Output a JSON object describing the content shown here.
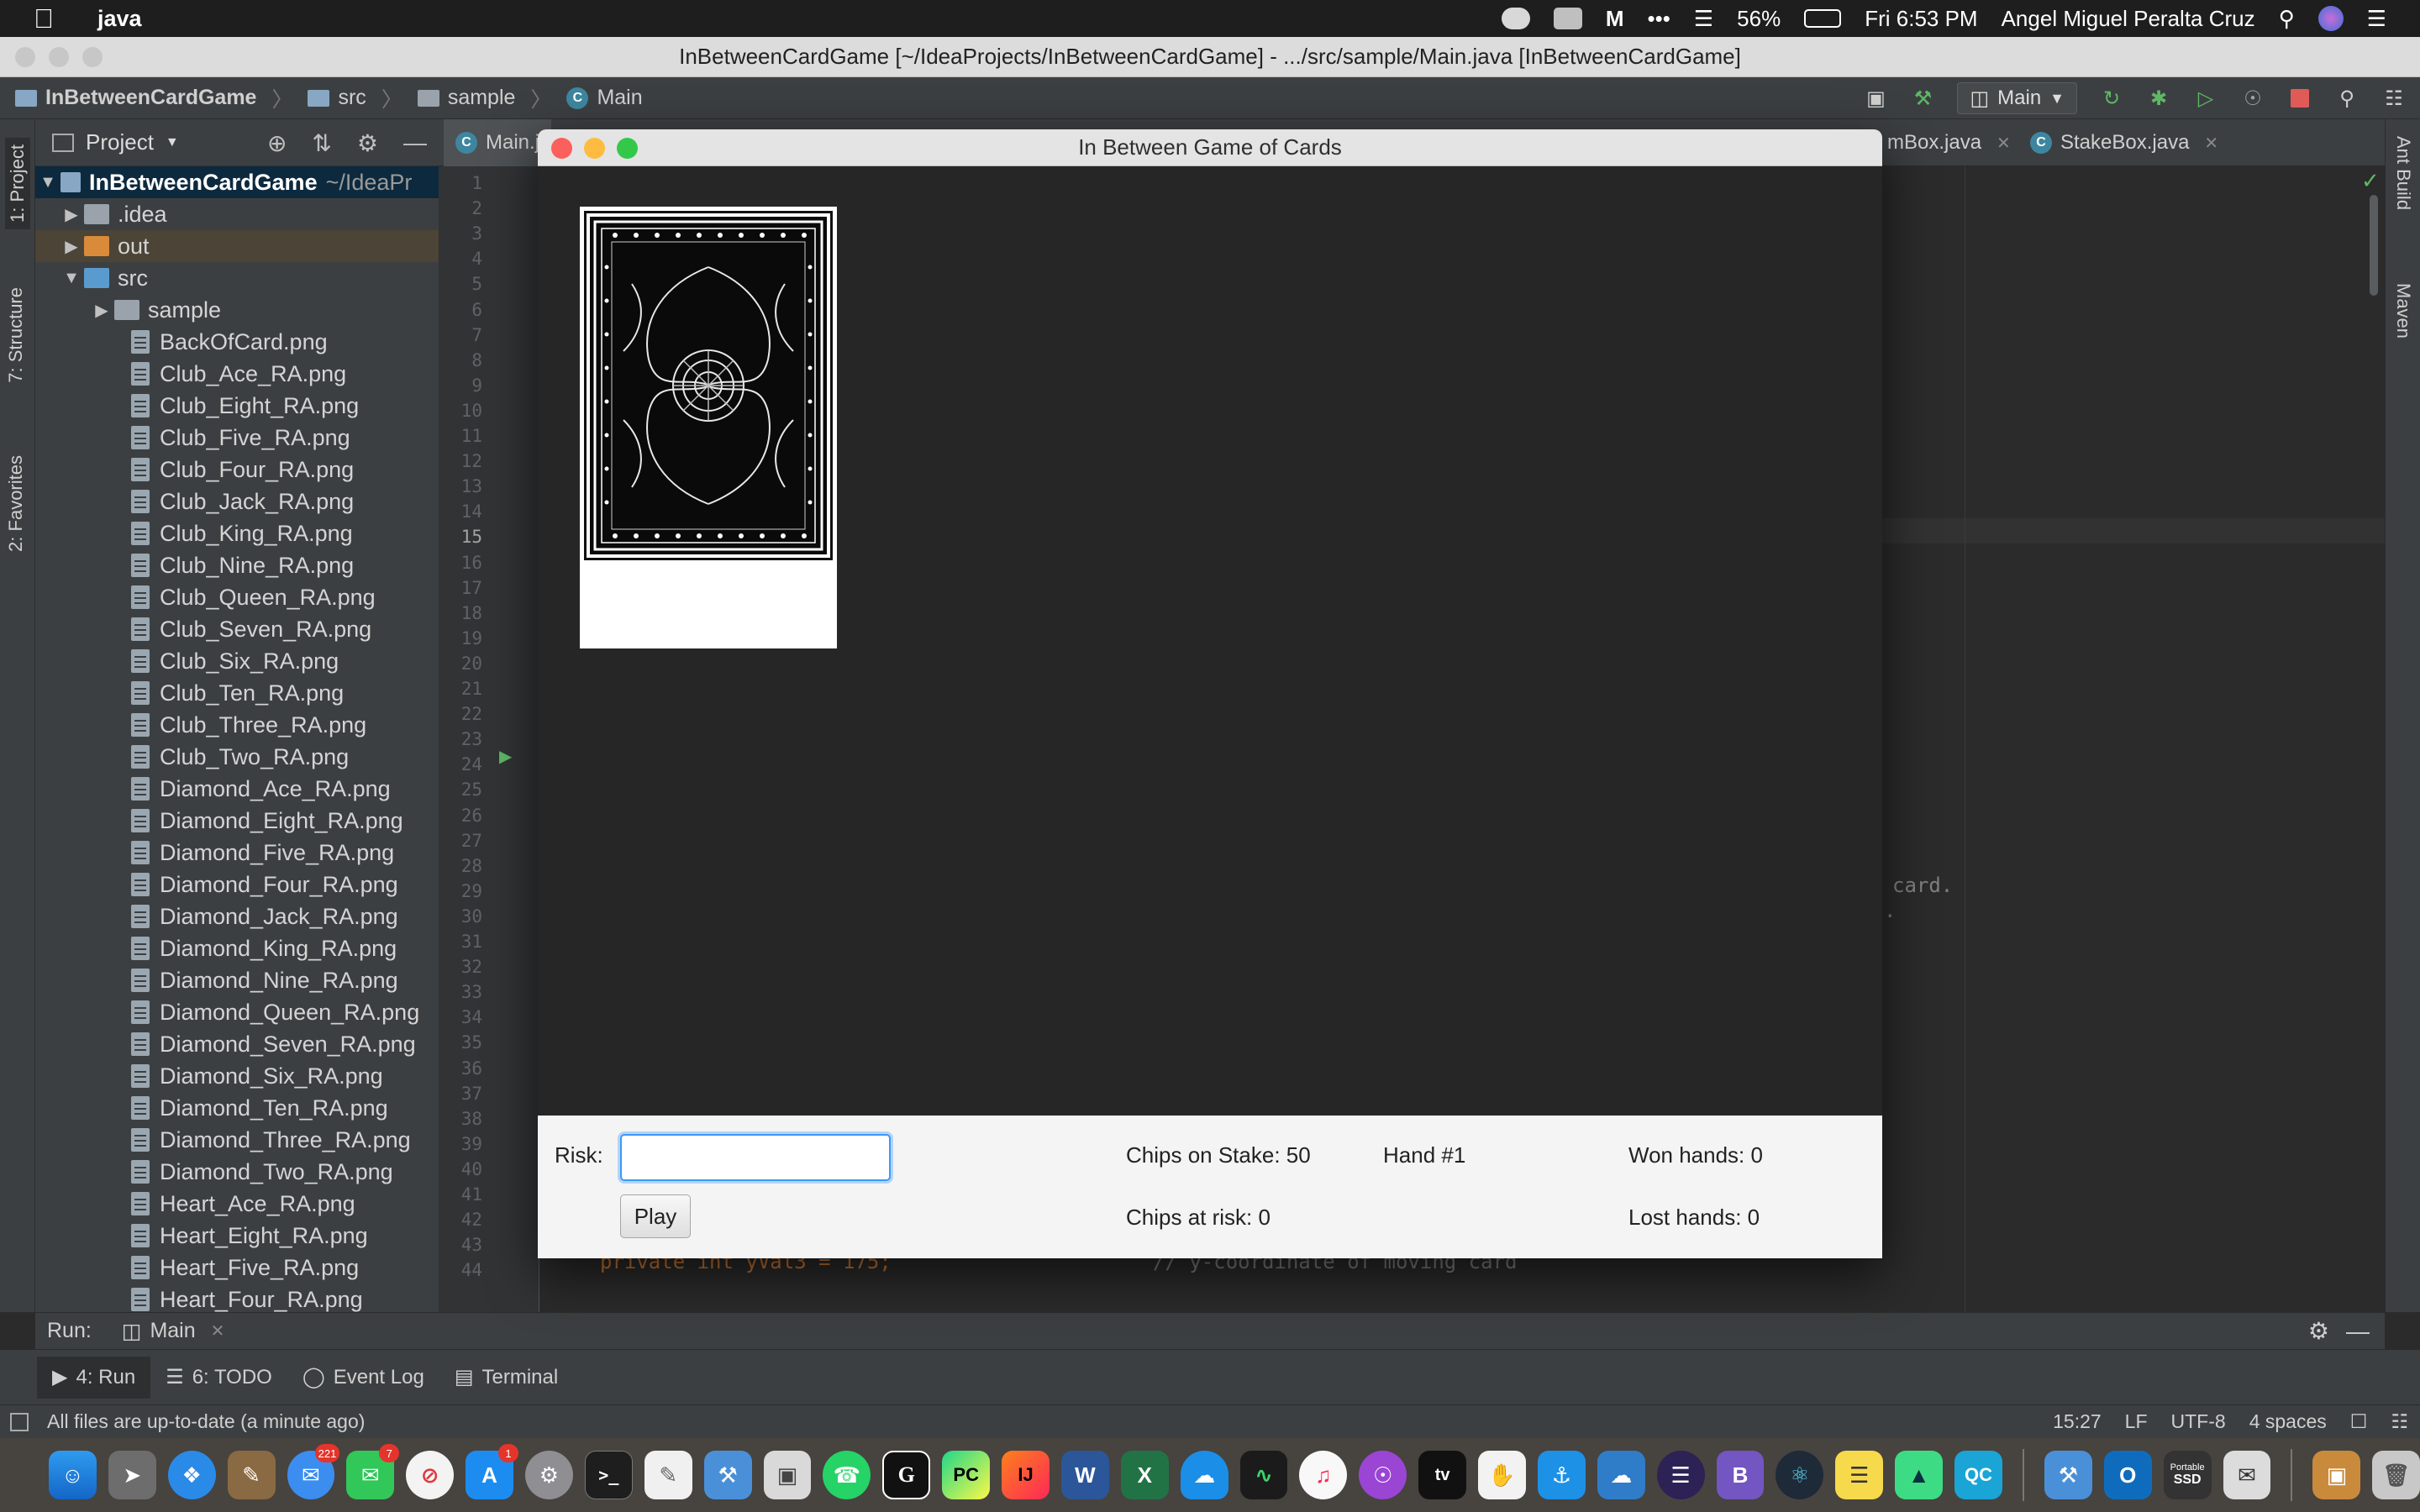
{
  "menubar": {
    "app_name": "java",
    "battery": "56%",
    "clock": "Fri 6:53 PM",
    "user": "Angel Miguel Peralta Cruz"
  },
  "window": {
    "title": "InBetweenCardGame [~/IdeaProjects/InBetweenCardGame] - .../src/sample/Main.java [InBetweenCardGame]"
  },
  "breadcrumb": [
    "InBetweenCardGame",
    "src",
    "sample",
    "Main"
  ],
  "toolbar": {
    "run_config": "Main"
  },
  "left_tabs": [
    "1: Project",
    "7: Structure",
    "2: Favorites"
  ],
  "right_tabs": [
    "Ant Build",
    "Maven"
  ],
  "project": {
    "header": "Project",
    "root": "InBetweenCardGame",
    "root_hint": "~/IdeaPr",
    "folders": [
      ".idea",
      "out",
      "src",
      "sample"
    ],
    "files": [
      "BackOfCard.png",
      "Club_Ace_RA.png",
      "Club_Eight_RA.png",
      "Club_Five_RA.png",
      "Club_Four_RA.png",
      "Club_Jack_RA.png",
      "Club_King_RA.png",
      "Club_Nine_RA.png",
      "Club_Queen_RA.png",
      "Club_Seven_RA.png",
      "Club_Six_RA.png",
      "Club_Ten_RA.png",
      "Club_Three_RA.png",
      "Club_Two_RA.png",
      "Diamond_Ace_RA.png",
      "Diamond_Eight_RA.png",
      "Diamond_Five_RA.png",
      "Diamond_Four_RA.png",
      "Diamond_Jack_RA.png",
      "Diamond_King_RA.png",
      "Diamond_Nine_RA.png",
      "Diamond_Queen_RA.png",
      "Diamond_Seven_RA.png",
      "Diamond_Six_RA.png",
      "Diamond_Ten_RA.png",
      "Diamond_Three_RA.png",
      "Diamond_Two_RA.png",
      "Heart_Ace_RA.png",
      "Heart_Eight_RA.png",
      "Heart_Five_RA.png",
      "Heart_Four_RA.png"
    ]
  },
  "editor": {
    "tabs": [
      "Main.j",
      "mBox.java",
      "StakeBox.java"
    ],
    "line_numbers": [
      "1",
      "2",
      "3",
      "4",
      "5",
      "6",
      "7",
      "8",
      "9",
      "10",
      "11",
      "12",
      "13",
      "14",
      "15",
      "16",
      "17",
      "18",
      "19",
      "20",
      "21",
      "22",
      "23",
      "24",
      "25",
      "26",
      "27",
      "28",
      "29",
      "30",
      "31",
      "32",
      "33",
      "34",
      "35",
      "36",
      "37",
      "38",
      "39",
      "40",
      "41",
      "42",
      "43",
      "44"
    ],
    "current_line": "15",
    "visible_code": [
      "card.",
      "."
    ],
    "partial_code_44": "private int yVal3 = 175;",
    "partial_comment_44": "// y-coordinate of moving card"
  },
  "fxwindow": {
    "title": "In Between Game of Cards",
    "risk_label": "Risk:",
    "risk_value": "",
    "play_label": "Play",
    "chips_stake": "Chips on Stake: 50",
    "chips_risk": "Chips at risk: 0",
    "hand": "Hand #1",
    "won": "Won hands: 0",
    "lost": "Lost hands: 0"
  },
  "run": {
    "label": "Run:",
    "config": "Main"
  },
  "tool_windows": [
    "4: Run",
    "6: TODO",
    "Event Log",
    "Terminal"
  ],
  "status": {
    "message": "All files are up-to-date (a minute ago)",
    "position": "15:27",
    "line_sep": "LF",
    "encoding": "UTF-8",
    "indent": "4 spaces"
  },
  "dock": {
    "badges": {
      "mail": "221",
      "messages": "7",
      "appstore": "1"
    },
    "labels": {
      "pycharm": "PC",
      "intellij": "IJ",
      "word": "W",
      "excel": "X",
      "qc": "QC",
      "outlook": "O",
      "appletv": "tv",
      "ssd_top": "Portable",
      "ssd_bottom": "SSD"
    }
  },
  "colors": {
    "ide_bg": "#2b2b2b",
    "panel_bg": "#3c3f41",
    "selection": "#0d293e",
    "accent_blue": "#3b99fc",
    "fx_close": "#fc605c",
    "fx_min": "#fdbc40",
    "fx_max": "#34c84a"
  }
}
